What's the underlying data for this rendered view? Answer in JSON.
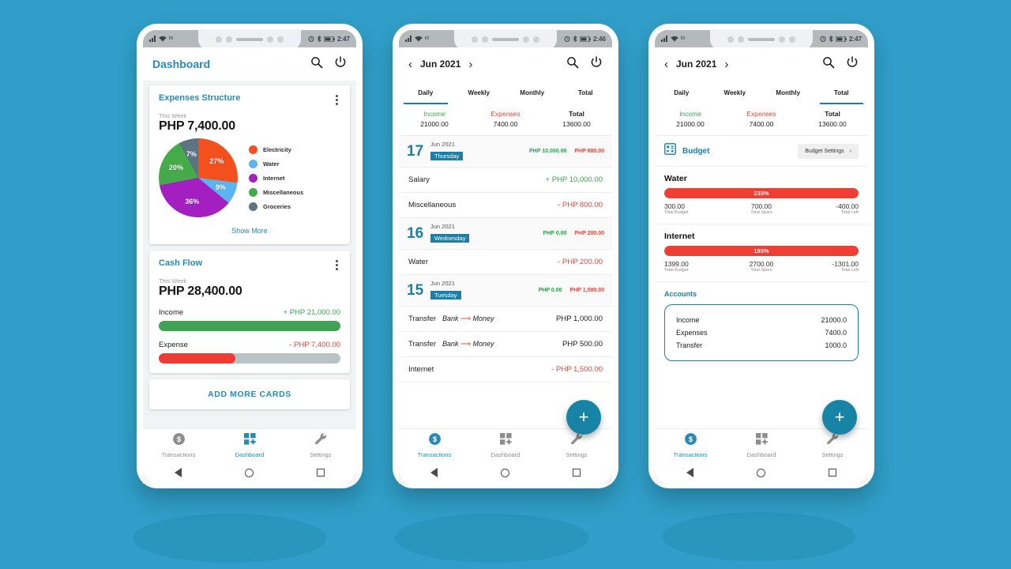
{
  "theme": {
    "background": "#309ec8",
    "accent": "#2989b5",
    "teal": "#1b7fa8",
    "fab": "#1784a6",
    "green": "#3fa255",
    "red": "#e0493c",
    "bar_red": "#ef3e33"
  },
  "phone1": {
    "statusbar": {
      "left_icons": "signal-wifi-sim",
      "time": "2:47",
      "right_icons": "alarm-bluetooth-battery"
    },
    "appbar": {
      "title": "Dashboard",
      "search_icon": "search-icon",
      "power_icon": "power-icon"
    },
    "expenses_card": {
      "title": "Expenses Structure",
      "period": "This Week",
      "amount": "PHP 7,400.00",
      "show_more": "Show More",
      "menu_icon": "kebab-menu-icon"
    },
    "cashflow_card": {
      "title": "Cash Flow",
      "period": "This Week",
      "amount": "PHP 28,400.00",
      "menu_icon": "kebab-menu-icon",
      "rows": [
        {
          "name": "Income",
          "value": "+ PHP 21,000.00",
          "color": "green",
          "pct": 100
        },
        {
          "name": "Expense",
          "value": "- PHP 7,400.00",
          "color": "red",
          "pct": 42
        }
      ]
    },
    "add_more_cards": "ADD MORE CARDS",
    "bottomnav": [
      {
        "label": "Transactions",
        "icon": "dollar-coin-icon",
        "active": false
      },
      {
        "label": "Dashboard",
        "icon": "grid-plus-icon",
        "active": true
      },
      {
        "label": "Settings",
        "icon": "wrench-icon",
        "active": false
      }
    ]
  },
  "chart_data": {
    "type": "pie",
    "title": "Expenses Structure",
    "subtitle": "This Week",
    "total": "PHP 7,400.00",
    "currency": "PHP",
    "categories": [
      "Electricity",
      "Water",
      "Internet",
      "Miscellaneous",
      "Groceries"
    ],
    "values": [
      27,
      9,
      36,
      20,
      7
    ],
    "value_labels": [
      "27%",
      "9%",
      "36%",
      "20%",
      "7%"
    ],
    "colors": [
      "#f4501e",
      "#5bb4ef",
      "#a31fc0",
      "#45ab4a",
      "#5c7480"
    ],
    "legend_position": "right",
    "grid": false
  },
  "phone2": {
    "statusbar": {
      "time": "2:46"
    },
    "appbar": {
      "month": "Jun 2021",
      "prev_icon": "chevron-left-icon",
      "next_icon": "chevron-right-icon",
      "search_icon": "search-icon",
      "power_icon": "power-icon"
    },
    "tabs": [
      {
        "label": "Daily",
        "active": true
      },
      {
        "label": "Weekly",
        "active": false
      },
      {
        "label": "Monthly",
        "active": false
      },
      {
        "label": "Total",
        "active": false
      }
    ],
    "summary": [
      {
        "header": "Income",
        "value": "21000.00"
      },
      {
        "header": "Expenses",
        "value": "7400.00"
      },
      {
        "header": "Total",
        "value": "13600.00"
      }
    ],
    "groups": [
      {
        "day": "17",
        "month": "Jun 2021",
        "weekday": "Thursday",
        "income": "PHP 10,000.00",
        "expense": "PHP 800.00",
        "rows": [
          {
            "cat": "Salary",
            "dir": "",
            "value": "+ PHP 10,000.00",
            "color": "green"
          },
          {
            "cat": "Miscellaneous",
            "dir": "",
            "value": "- PHP 800.00",
            "color": "red"
          }
        ]
      },
      {
        "day": "16",
        "month": "Jun 2021",
        "weekday": "Wednesday",
        "income": "PHP 0.00",
        "expense": "PHP 200.00",
        "rows": [
          {
            "cat": "Water",
            "dir": "",
            "value": "- PHP 200.00",
            "color": "red"
          }
        ]
      },
      {
        "day": "15",
        "month": "Jun 2021",
        "weekday": "Tuesday",
        "income": "PHP 0.00",
        "expense": "PHP 1,500.00",
        "rows": [
          {
            "cat": "Transfer",
            "dir": "Bank → Money",
            "value": "PHP 1,000.00",
            "color": "dark"
          },
          {
            "cat": "Transfer",
            "dir": "Bank → Money",
            "value": "PHP 500.00",
            "color": "dark"
          },
          {
            "cat": "Internet",
            "dir": "",
            "value": "- PHP 1,500.00",
            "color": "red"
          }
        ]
      }
    ],
    "fab": "+",
    "bottomnav": [
      {
        "label": "Transactions",
        "icon": "dollar-coin-icon",
        "active": true
      },
      {
        "label": "Dashboard",
        "icon": "grid-plus-icon",
        "active": false
      },
      {
        "label": "Settings",
        "icon": "wrench-icon",
        "active": false
      }
    ]
  },
  "phone3": {
    "statusbar": {
      "time": "2:47"
    },
    "appbar": {
      "month": "Jun 2021",
      "prev_icon": "chevron-left-icon",
      "next_icon": "chevron-right-icon",
      "search_icon": "search-icon",
      "power_icon": "power-icon"
    },
    "tabs": [
      {
        "label": "Daily",
        "active": false
      },
      {
        "label": "Weekly",
        "active": false
      },
      {
        "label": "Monthly",
        "active": false
      },
      {
        "label": "Total",
        "active": true
      }
    ],
    "summary": [
      {
        "header": "Income",
        "value": "21000.00"
      },
      {
        "header": "Expenses",
        "value": "7400.00"
      },
      {
        "header": "Total",
        "value": "13600.00"
      }
    ],
    "budget": {
      "icon": "budget-grid-icon",
      "title": "Budget",
      "settings_label": "Budget Settings",
      "settings_icon": "chevron-right-icon",
      "items": [
        {
          "name": "Water",
          "percent": "233%",
          "fill": 100,
          "total_budget": "300.00",
          "total_budget_key": "Total Budget",
          "total_spent": "700.00",
          "total_spent_key": "Total Spent",
          "total_left": "-400.00",
          "total_left_key": "Total Left"
        },
        {
          "name": "Internet",
          "percent": "193%",
          "fill": 100,
          "total_budget": "1399.00",
          "total_budget_key": "Total Budget",
          "total_spent": "2700.00",
          "total_spent_key": "Total Spent",
          "total_left": "-1301.00",
          "total_left_key": "Total Left"
        }
      ]
    },
    "accounts": {
      "title": "Accounts",
      "rows": [
        {
          "key": "Income",
          "value": "21000.0"
        },
        {
          "key": "Expenses",
          "value": "7400.0"
        },
        {
          "key": "Transfer",
          "value": "1000.0"
        }
      ]
    },
    "fab": "+",
    "bottomnav": [
      {
        "label": "Transactions",
        "icon": "dollar-coin-icon",
        "active": true
      },
      {
        "label": "Dashboard",
        "icon": "grid-plus-icon",
        "active": false
      },
      {
        "label": "Settings",
        "icon": "wrench-icon",
        "active": false
      }
    ]
  }
}
